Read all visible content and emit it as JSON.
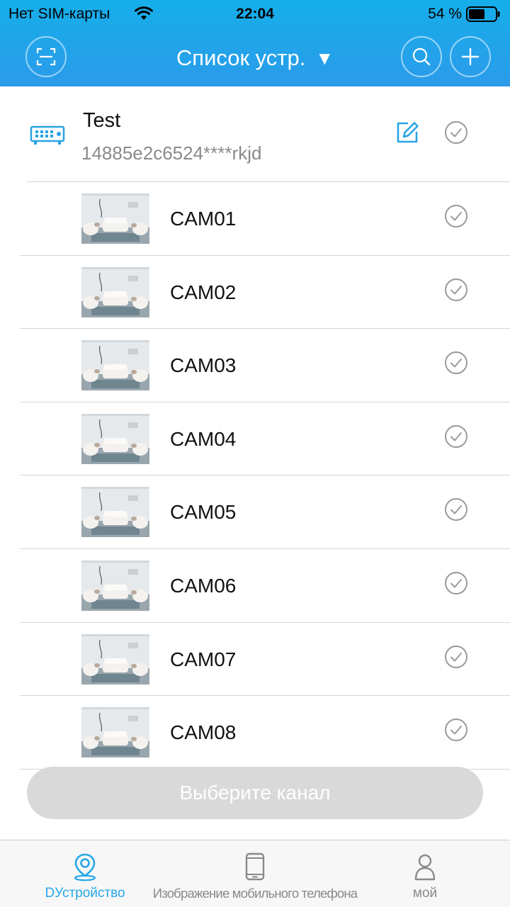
{
  "status_bar": {
    "carrier": "Нет SIM-карты",
    "time": "22:04",
    "battery": "54 %"
  },
  "header": {
    "title": "Список устр.",
    "dropdown_caret": "▼",
    "scan_icon": "scan-icon",
    "search_icon": "search-icon",
    "add_icon": "plus-icon"
  },
  "device": {
    "name": "Test",
    "serial": "14885e2c6524****rkjd",
    "icon": "nvr-device-icon"
  },
  "cameras": [
    {
      "name": "CAM01"
    },
    {
      "name": "CAM02"
    },
    {
      "name": "CAM03"
    },
    {
      "name": "CAM04"
    },
    {
      "name": "CAM05"
    },
    {
      "name": "CAM06"
    },
    {
      "name": "CAM07"
    },
    {
      "name": "CAM08"
    }
  ],
  "select_button": {
    "label": "Выберите канал"
  },
  "tabbar": {
    "tabs": [
      {
        "label": "DУстройство",
        "icon": "location-pin-icon",
        "active": true
      },
      {
        "label": "Изображение мобильного телефона",
        "icon": "phone-icon",
        "active": false
      },
      {
        "label": "мой",
        "icon": "person-icon",
        "active": false
      }
    ]
  },
  "colors": {
    "header_bg": "#1aa6ea",
    "accent": "#25a7e8",
    "disabled_button": "#d9d9d9",
    "check_gray": "#9a9a9a"
  }
}
